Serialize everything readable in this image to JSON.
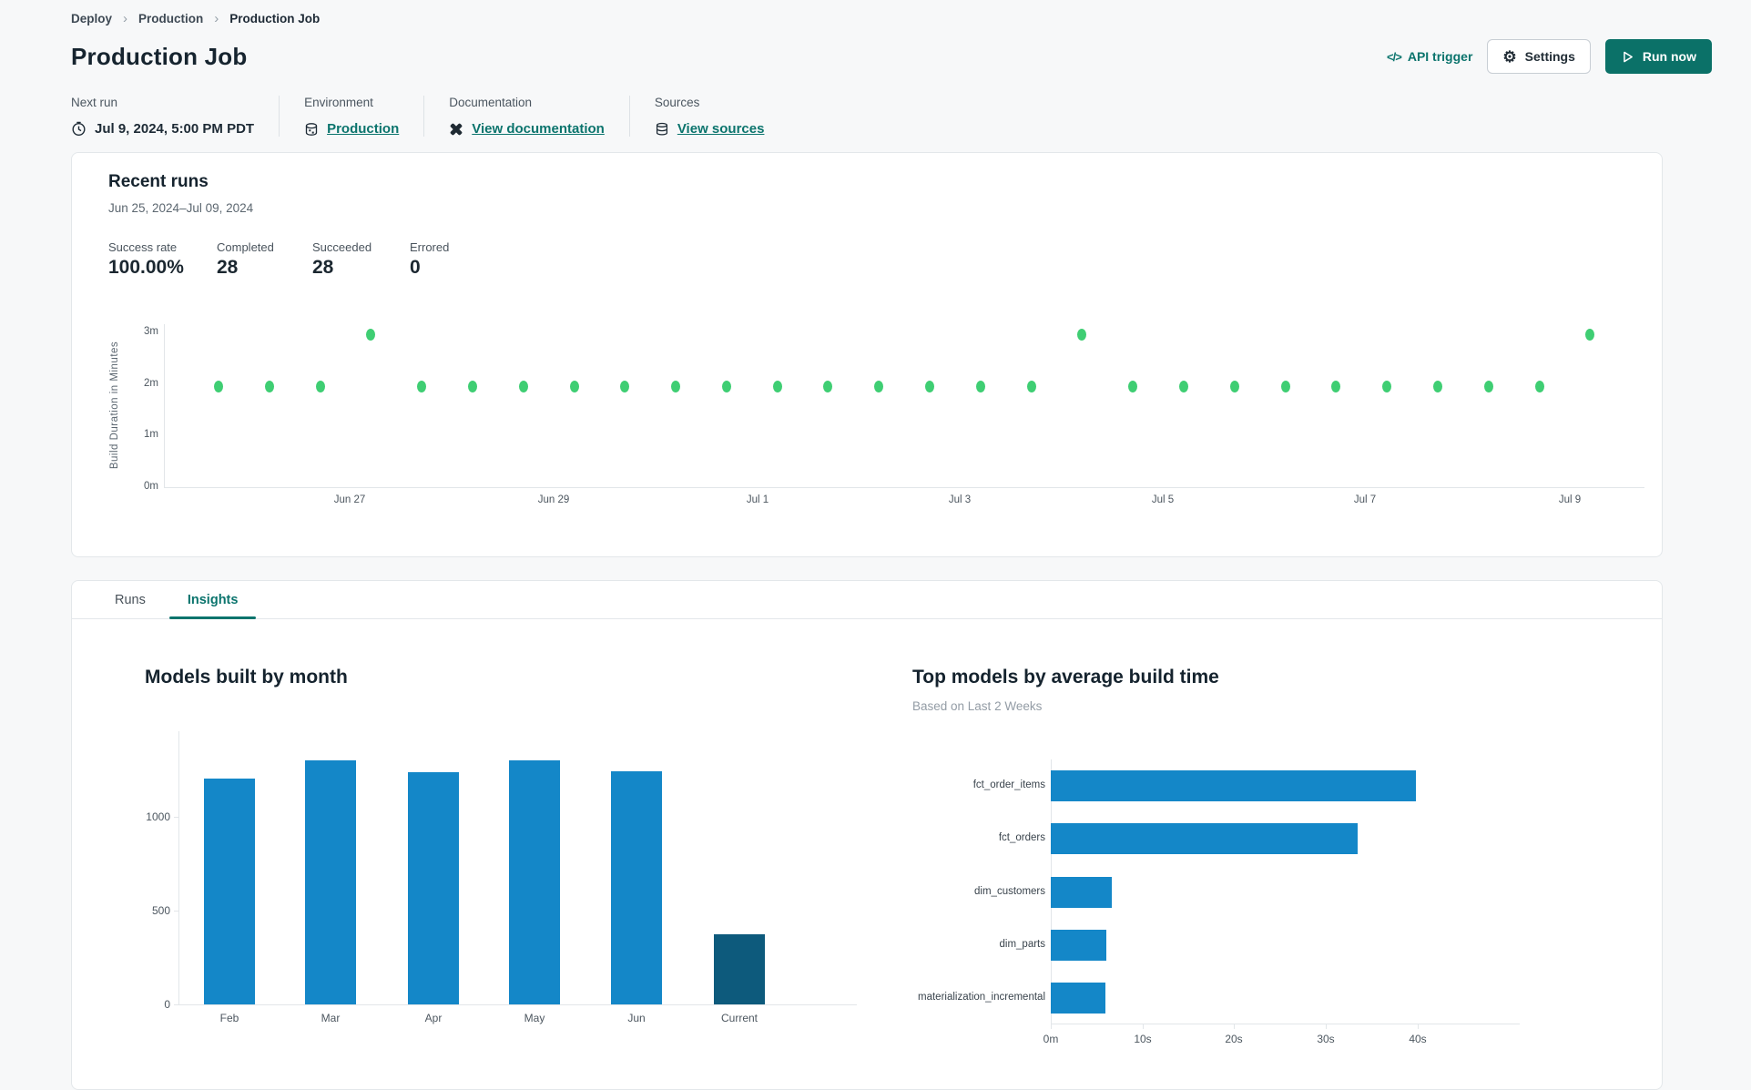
{
  "breadcrumb": {
    "items": [
      {
        "label": "Deploy"
      },
      {
        "label": "Production"
      },
      {
        "label": "Production Job"
      }
    ]
  },
  "page": {
    "title": "Production Job"
  },
  "header": {
    "api_trigger_label": "API trigger",
    "code_glyph": "</>",
    "settings_label": "Settings",
    "run_now_label": "Run now"
  },
  "info": {
    "next_run": {
      "label": "Next run",
      "value": "Jul 9, 2024, 5:00 PM PDT"
    },
    "environment": {
      "label": "Environment",
      "value": "Production"
    },
    "documentation": {
      "label": "Documentation",
      "value": "View documentation"
    },
    "sources": {
      "label": "Sources",
      "value": "View sources"
    }
  },
  "recent_runs": {
    "title": "Recent runs",
    "date_range": "Jun 25, 2024–Jul 09, 2024",
    "stats": [
      {
        "label": "Success rate",
        "value": "100.00%"
      },
      {
        "label": "Completed",
        "value": "28"
      },
      {
        "label": "Succeeded",
        "value": "28"
      },
      {
        "label": "Errored",
        "value": "0"
      }
    ]
  },
  "tabs": [
    {
      "label": "Runs"
    },
    {
      "label": "Insights"
    }
  ],
  "colors": {
    "accent_teal": "#0b746d",
    "dot_green": "#3fce73",
    "bar_blue": "#1487c8",
    "bar_dark_blue": "#0d5a7c"
  },
  "chart_data": [
    {
      "id": "recent-runs-build-duration",
      "type": "scatter",
      "ylabel": "Build Duration in Minutes",
      "yticks": [
        "0m",
        "1m",
        "2m",
        "3m"
      ],
      "ylim_minutes": [
        0,
        3.2
      ],
      "xticks": [
        "Jun 27",
        "Jun 29",
        "Jul 1",
        "Jul 3",
        "Jul 5",
        "Jul 7",
        "Jul 9"
      ],
      "x_range": [
        "Jun 25, 2024",
        "Jul 09, 2024"
      ],
      "point_color": "#3fce73",
      "points_minutes": [
        1.95,
        1.95,
        1.95,
        2.95,
        1.95,
        1.95,
        1.95,
        1.95,
        1.95,
        1.95,
        1.95,
        1.95,
        1.95,
        1.95,
        1.95,
        1.95,
        1.95,
        2.95,
        1.95,
        1.95,
        1.95,
        1.95,
        1.95,
        1.95,
        1.95,
        1.95,
        1.95,
        2.95
      ]
    },
    {
      "id": "models-built-by-month",
      "type": "bar",
      "title": "Models built by month",
      "categories": [
        "Feb",
        "Mar",
        "Apr",
        "May",
        "Jun",
        "Current"
      ],
      "values": [
        1205,
        1300,
        1240,
        1300,
        1245,
        375
      ],
      "yticks": [
        0,
        500,
        1000
      ],
      "ylim": [
        0,
        1350
      ],
      "bar_color": "#1487c8",
      "current_bar_color": "#0d5a7c",
      "highlight_index": 5
    },
    {
      "id": "top-models-by-avg-build-time",
      "type": "bar-horizontal",
      "title": "Top models by average build time",
      "subtitle": "Based on Last 2 Weeks",
      "categories": [
        "fct_order_items",
        "fct_orders",
        "dim_customers",
        "dim_parts",
        "materialization_incremental"
      ],
      "values_seconds": [
        39.8,
        33.4,
        6.6,
        6.1,
        6.0
      ],
      "xticks": [
        "0m",
        "10s",
        "20s",
        "30s",
        "40s"
      ],
      "xlim_seconds": [
        0,
        43
      ],
      "bar_color": "#1487c8"
    }
  ]
}
